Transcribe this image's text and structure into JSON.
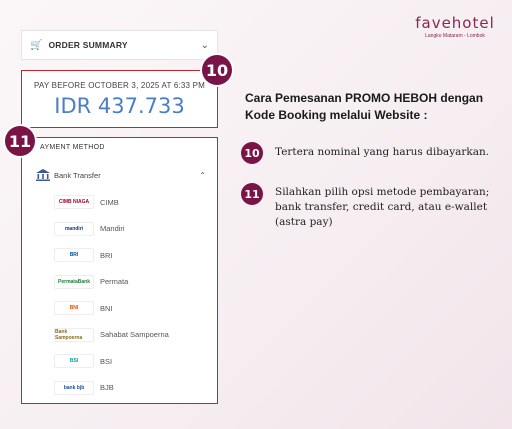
{
  "logo": {
    "name": "favehotel",
    "sub": "Langko Mataram - Lombok"
  },
  "order_summary": {
    "title": "ORDER SUMMARY"
  },
  "payment": {
    "deadline": "PAY BEFORE OCTOBER 3, 2025 AT 6:33 PM",
    "amount": "IDR 437.733"
  },
  "badges": {
    "b10": "10",
    "b11": "11"
  },
  "payment_method": {
    "title": "AYMENT METHOD",
    "bank_transfer": "Bank Transfer",
    "banks": [
      {
        "logo": "CIMB NIAGA",
        "name": "CIMB",
        "color": "#a3002a"
      },
      {
        "logo": "mandiri",
        "name": "Mandiri",
        "color": "#0b3a7a"
      },
      {
        "logo": "BRI",
        "name": "BRI",
        "color": "#00529c"
      },
      {
        "logo": "PermataBank",
        "name": "Permata",
        "color": "#1e7a3c"
      },
      {
        "logo": "BNI",
        "name": "BNI",
        "color": "#e35205"
      },
      {
        "logo": "Bank Sampoerna",
        "name": "Sahabat Sampoerna",
        "color": "#8a6a1f"
      },
      {
        "logo": "BSI",
        "name": "BSI",
        "color": "#00a39e"
      },
      {
        "logo": "bank bjb",
        "name": "BJB",
        "color": "#1a4f9c"
      }
    ]
  },
  "instructions": {
    "heading": "Cara Pemesanan PROMO HEBOH dengan Kode Booking melalui Website :",
    "items": [
      {
        "num": "10",
        "text": "Tertera nominal yang harus dibayarkan."
      },
      {
        "num": "11",
        "text": "Silahkan pilih opsi metode pembayaran; bank transfer, credit card, atau e-wallet (astra pay)"
      }
    ]
  },
  "colors": {
    "accent": "#7a1447",
    "highlight_border": "#c0262e",
    "amount": "#4a7ec8"
  }
}
